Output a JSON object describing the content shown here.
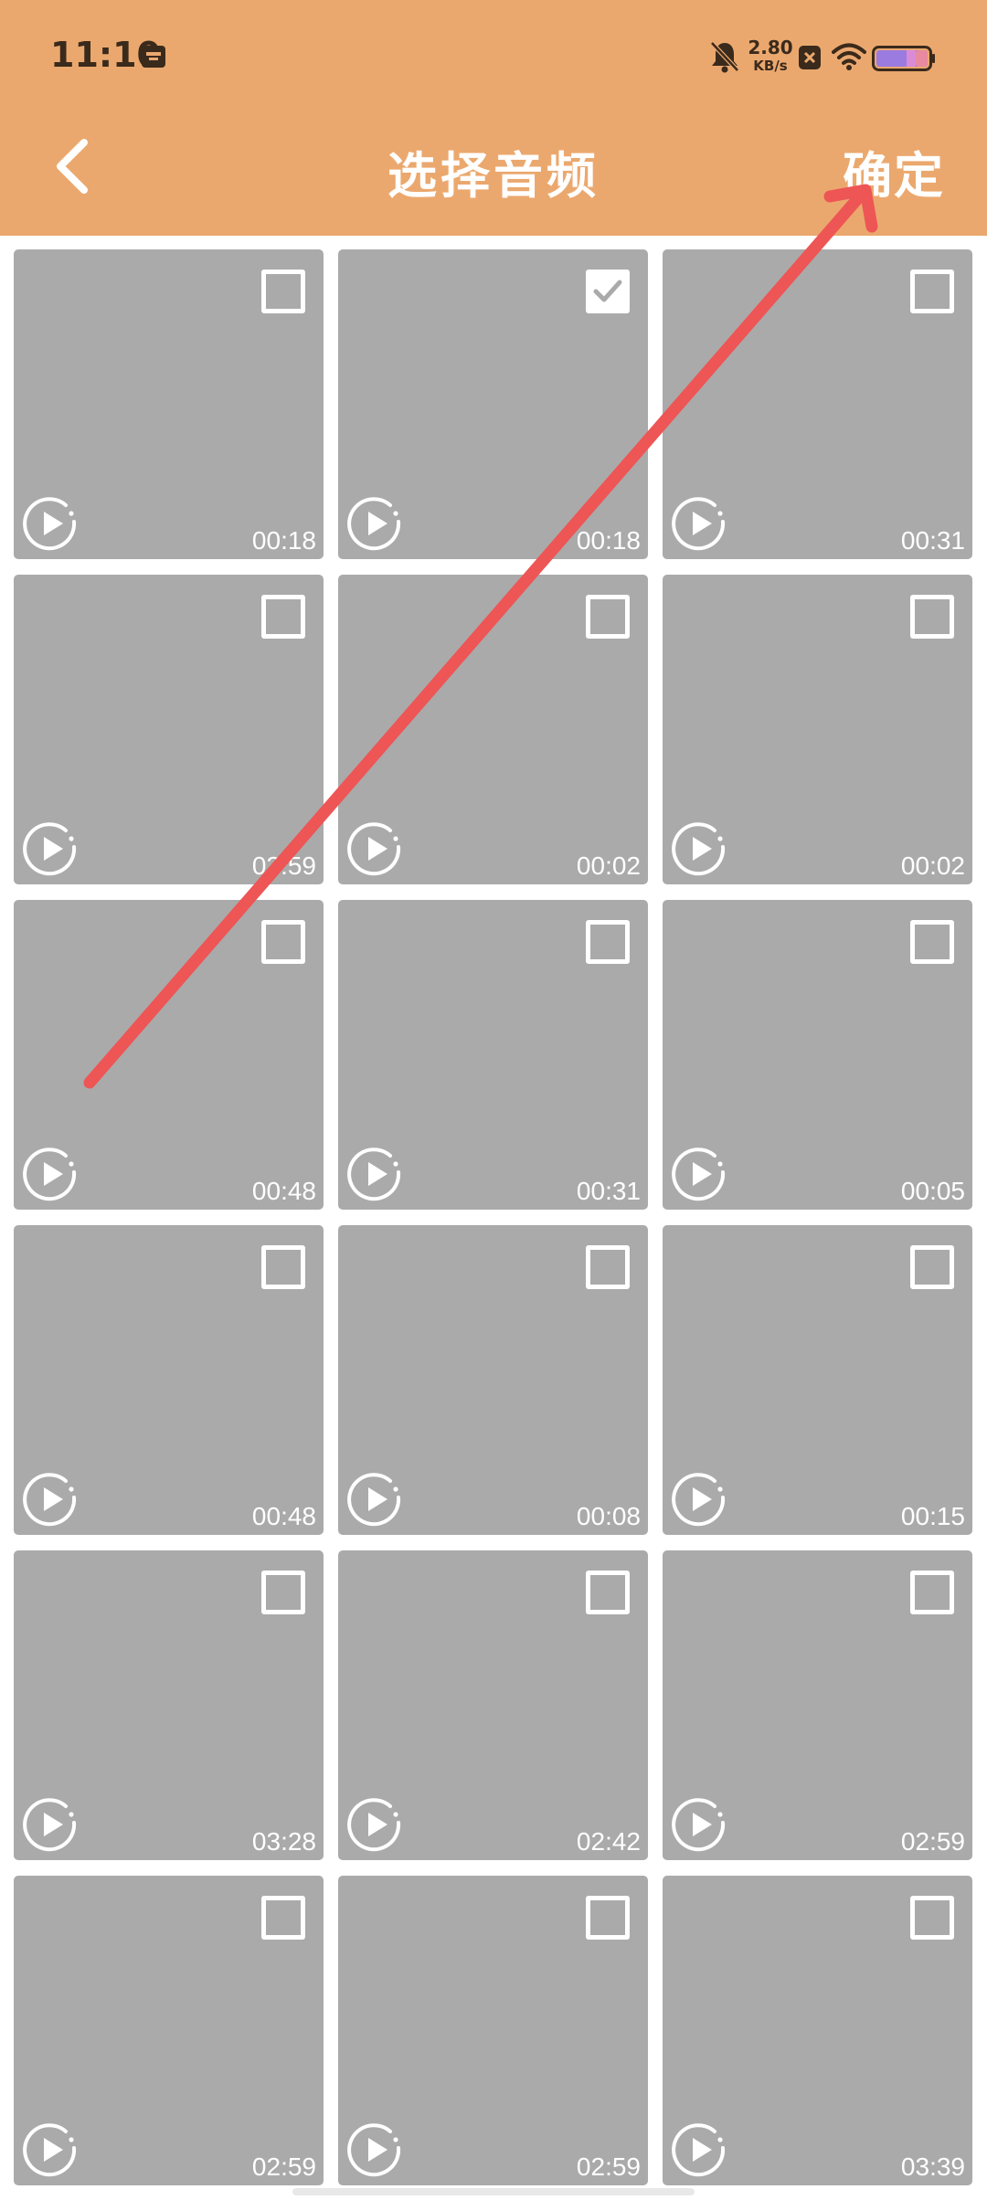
{
  "status_bar": {
    "time": "11:10",
    "net_speed_value": "2.80",
    "net_speed_unit": "KB/s",
    "icons": [
      "calendar-icon",
      "bell-muted-icon",
      "close-badge-icon",
      "wifi-icon",
      "battery-icon"
    ]
  },
  "header": {
    "title": "选择音频",
    "confirm_label": "确定",
    "back_icon": "chevron-left-icon"
  },
  "colors": {
    "header_bg": "#EBA86E",
    "tile_bg": "#AAAAAA",
    "annotation_arrow": "#EE5555"
  },
  "tiles": [
    {
      "duration": "00:18",
      "checked": false
    },
    {
      "duration": "00:18",
      "checked": true
    },
    {
      "duration": "00:31",
      "checked": false
    },
    {
      "duration": "03:59",
      "checked": false
    },
    {
      "duration": "00:02",
      "checked": false
    },
    {
      "duration": "00:02",
      "checked": false
    },
    {
      "duration": "00:48",
      "checked": false
    },
    {
      "duration": "00:31",
      "checked": false
    },
    {
      "duration": "00:05",
      "checked": false
    },
    {
      "duration": "00:48",
      "checked": false
    },
    {
      "duration": "00:08",
      "checked": false
    },
    {
      "duration": "00:15",
      "checked": false
    },
    {
      "duration": "03:28",
      "checked": false
    },
    {
      "duration": "02:42",
      "checked": false
    },
    {
      "duration": "02:59",
      "checked": false
    },
    {
      "duration": "02:59",
      "checked": false
    },
    {
      "duration": "02:59",
      "checked": false
    },
    {
      "duration": "03:39",
      "checked": false
    }
  ]
}
